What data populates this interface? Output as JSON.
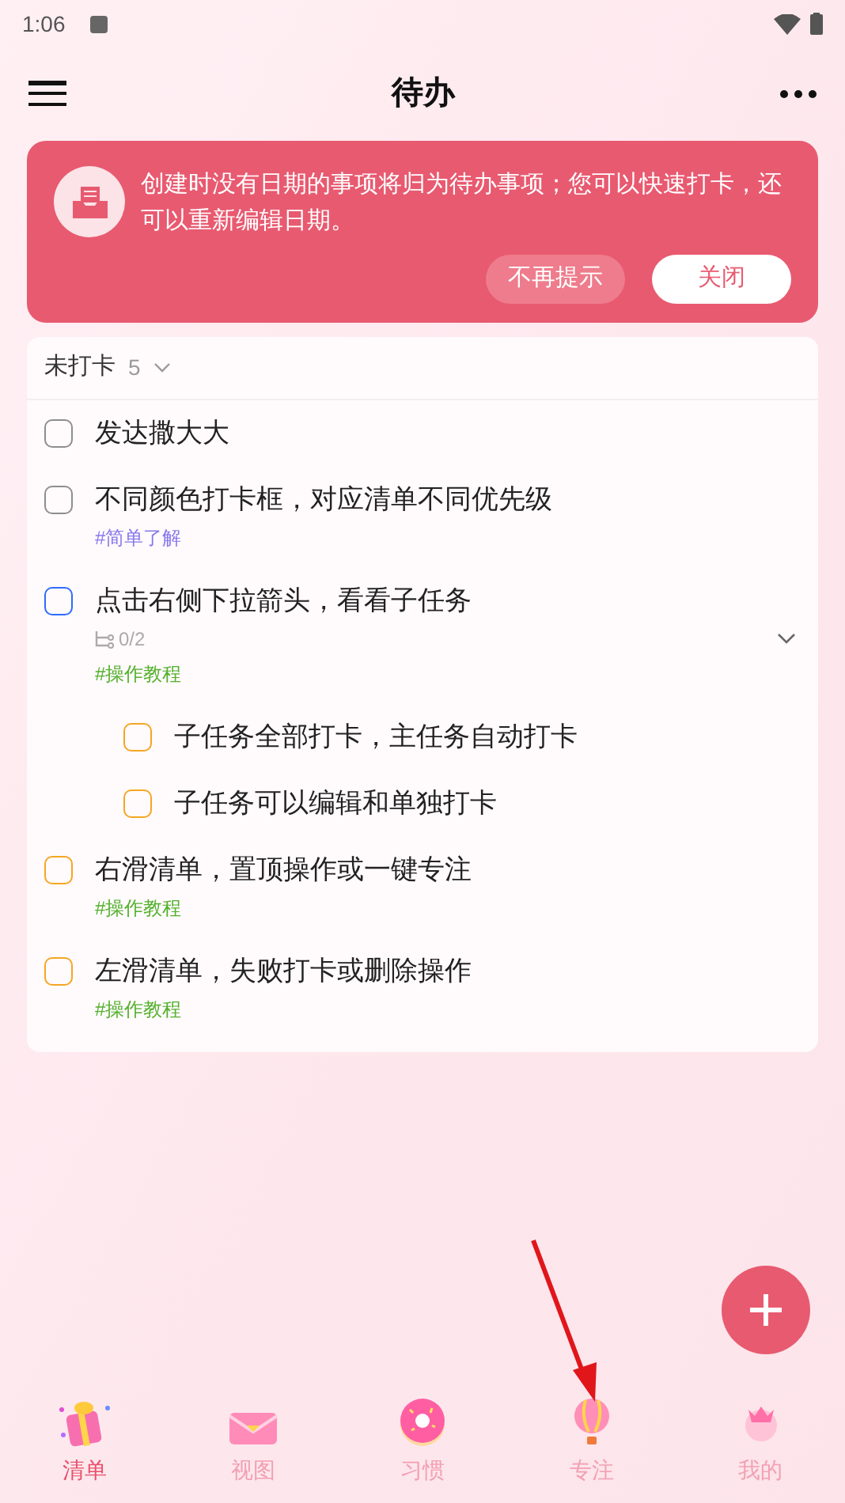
{
  "status_bar": {
    "time": "1:06"
  },
  "header": {
    "title": "待办"
  },
  "notice": {
    "text": "创建时没有日期的事项将归为待办事项；您可以快速打卡，还可以重新编辑日期。",
    "buttons": [
      {
        "label": "不再提示",
        "kind": "secondary"
      },
      {
        "label": "关闭",
        "kind": "primary"
      }
    ]
  },
  "section": {
    "title": "未打卡",
    "count": "5",
    "expanded": true
  },
  "tasks": [
    {
      "title": "发达撒大大",
      "color": "#8e8e8e",
      "checked": false
    },
    {
      "title": "不同颜色打卡框，对应清单不同优先级",
      "color": "#8e8e8e",
      "checked": false,
      "tag": {
        "text": "#简单了解",
        "color": "#8878ee"
      }
    },
    {
      "title": "点击右侧下拉箭头，看看子任务",
      "color": "#2f6bff",
      "checked": false,
      "subtask_count": "0/2",
      "expanded": true,
      "tag": {
        "text": "#操作教程",
        "color": "#52b02c"
      },
      "children": [
        {
          "title": "子任务全部打卡，主任务自动打卡",
          "color": "#f5a623",
          "checked": false
        },
        {
          "title": "子任务可以编辑和单独打卡",
          "color": "#f5a623",
          "checked": false
        }
      ]
    },
    {
      "title": "右滑清单，置顶操作或一键专注",
      "color": "#f5a623",
      "checked": false,
      "tag": {
        "text": "#操作教程",
        "color": "#52b02c"
      }
    },
    {
      "title": "左滑清单，失败打卡或删除操作",
      "color": "#f5a623",
      "checked": false,
      "tag": {
        "text": "#操作教程",
        "color": "#52b02c"
      }
    }
  ],
  "bottom_nav": [
    {
      "label": "清单",
      "kind": "gift",
      "selected": true
    },
    {
      "label": "视图",
      "kind": "envelope",
      "selected": false
    },
    {
      "label": "习惯",
      "kind": "donut",
      "selected": false
    },
    {
      "label": "专注",
      "kind": "balloon",
      "selected": false
    },
    {
      "label": "我的",
      "kind": "crown",
      "selected": false
    }
  ]
}
